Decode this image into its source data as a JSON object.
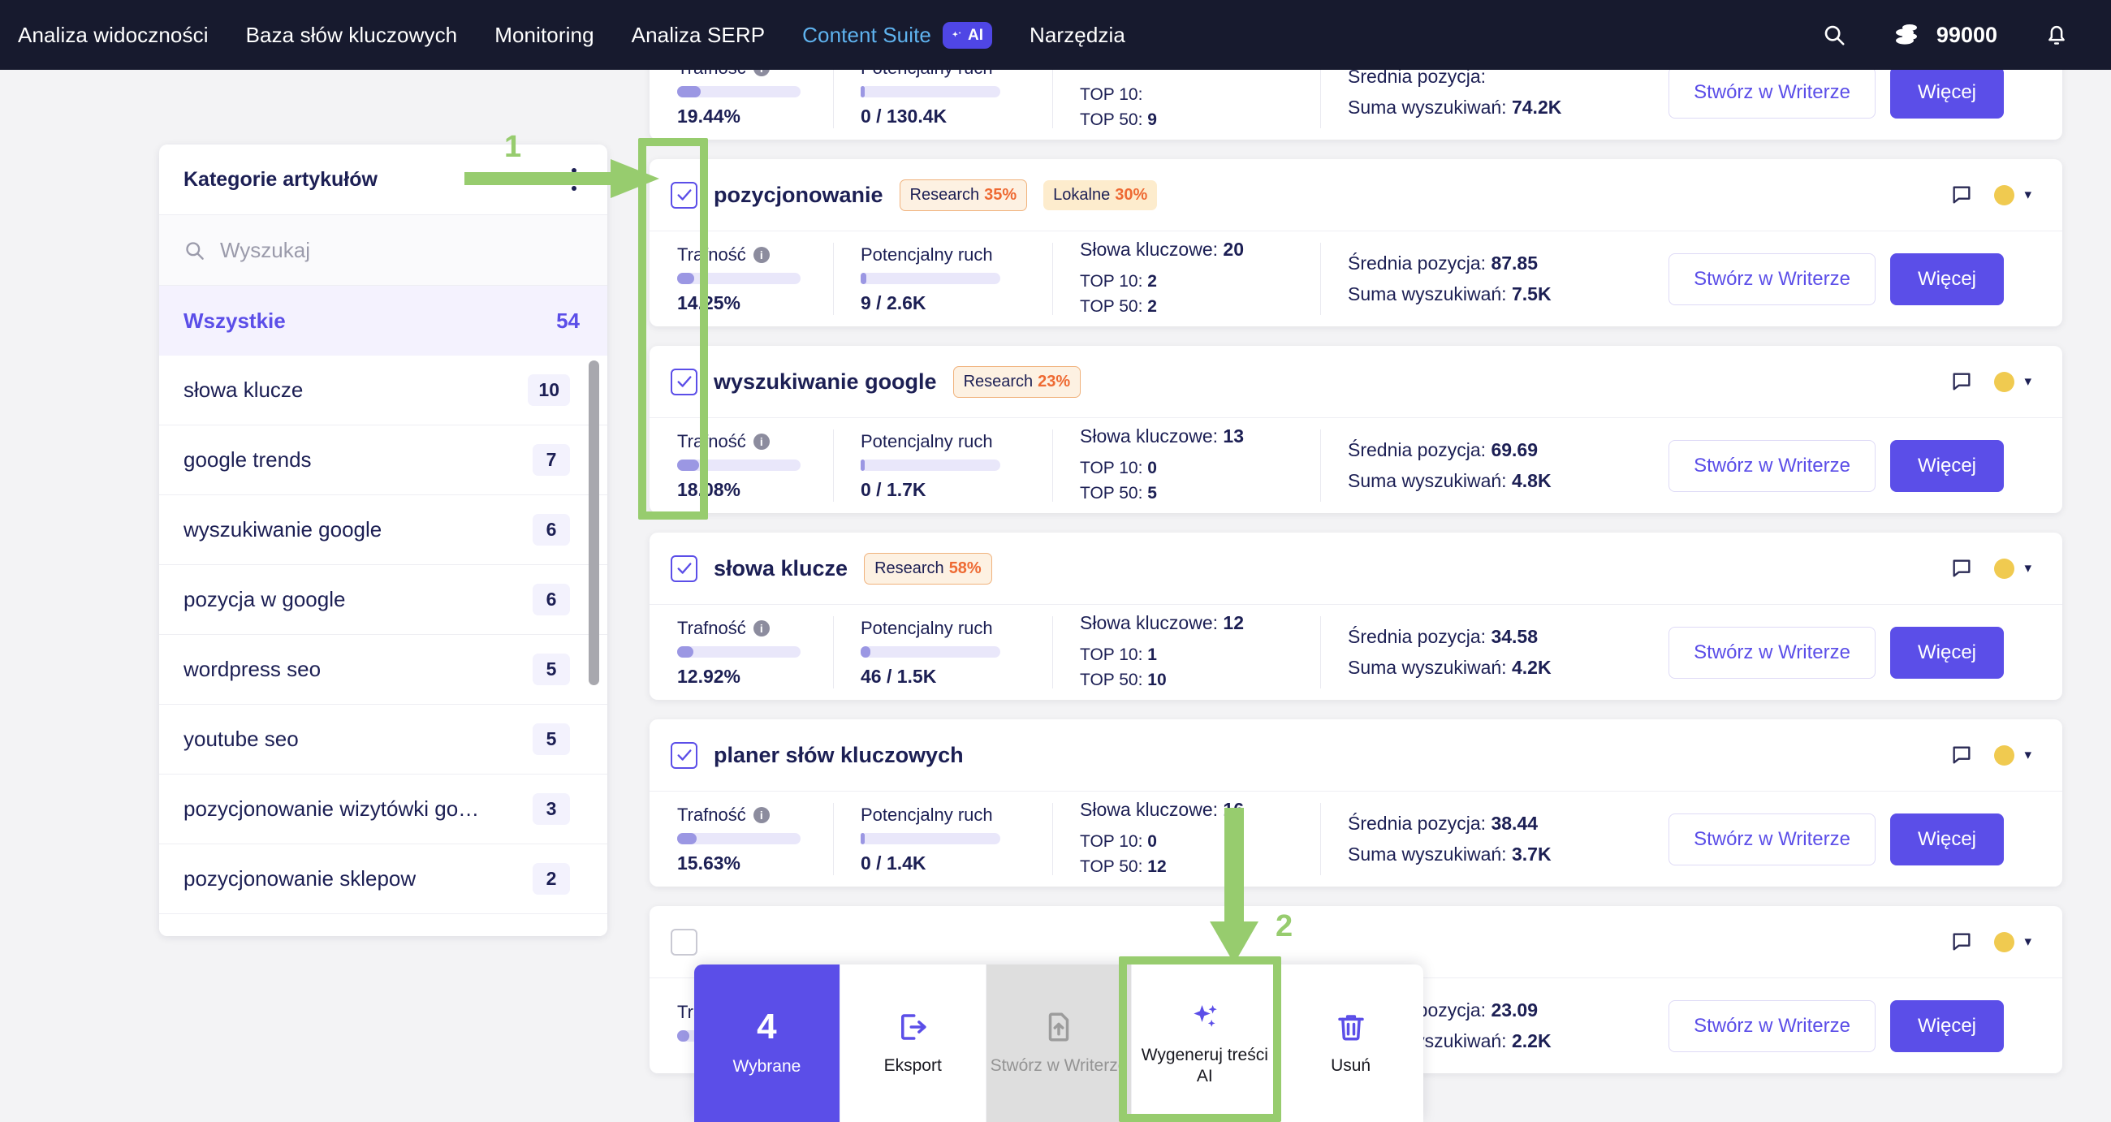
{
  "topnav": {
    "items": [
      {
        "label": "Analiza widoczności",
        "active": false
      },
      {
        "label": "Baza słów kluczowych",
        "active": false
      },
      {
        "label": "Monitoring",
        "active": false
      },
      {
        "label": "Analiza SERP",
        "active": false
      },
      {
        "label": "Content Suite",
        "active": true,
        "badge": "AI"
      },
      {
        "label": "Narzędzia",
        "active": false
      }
    ],
    "ai_badge_label": "AI",
    "credits": "99000",
    "search_icon": "search-icon",
    "coins_icon": "coins-icon",
    "bell_icon": "bell-icon",
    "accent_active": "#5fb3ef",
    "bg": "#171a2e"
  },
  "sidebar": {
    "title": "Kategorie artykułów",
    "menu_icon": "kebab-menu-icon",
    "search": {
      "placeholder": "Wyszukaj",
      "value": "",
      "icon": "search-icon"
    },
    "all": {
      "label": "Wszystkie",
      "count": "54"
    },
    "items": [
      {
        "label": "słowa klucze",
        "count": "10"
      },
      {
        "label": "google trends",
        "count": "7"
      },
      {
        "label": "wyszukiwanie google",
        "count": "6"
      },
      {
        "label": "pozycja w google",
        "count": "6"
      },
      {
        "label": "wordpress seo",
        "count": "5"
      },
      {
        "label": "youtube seo",
        "count": "5"
      },
      {
        "label": "pozycjonowanie wizytówki go…",
        "count": "3"
      },
      {
        "label": "pozycjonowanie sklepow",
        "count": "2"
      },
      {
        "label": "",
        "count": ""
      }
    ]
  },
  "labels": {
    "trafnosc": "Trafność",
    "potencjalny_ruch": "Potencjalny ruch",
    "slowa_kluczowe": "Słowa kluczowe:",
    "top10": "TOP 10:",
    "top50": "TOP 50:",
    "srednia_pozycja": "Średnia pozycja:",
    "suma_wyszukiwan": "Suma wyszukiwań:",
    "btn_writer": "Stwórz w Writerze",
    "btn_more": "Więcej",
    "info_icon": "info-icon",
    "comment_icon": "comment-icon",
    "status_dot": "status-dot-icon",
    "chevron": "chevron-down-icon"
  },
  "cards": [
    {
      "name": "",
      "checked": true,
      "badges": [],
      "trafnosc": "19.44%",
      "trafnosc_pct": 19,
      "ruch": "0 / 130.4K",
      "ruch_pct": 3,
      "keywords": "",
      "top10": "",
      "top50": "9",
      "srednia": "",
      "suma": "74.2K",
      "partial": true
    },
    {
      "name": "pozycjonowanie",
      "checked": true,
      "badges": [
        {
          "key": "Research",
          "value": "35%",
          "style": "outline"
        },
        {
          "key": "Lokalne",
          "value": "30%",
          "style": "solid"
        }
      ],
      "trafnosc": "14.25%",
      "trafnosc_pct": 14,
      "ruch": "9 / 2.6K",
      "ruch_pct": 4,
      "keywords": "20",
      "top10": "2",
      "top50": "2",
      "srednia": "87.85",
      "suma": "7.5K"
    },
    {
      "name": "wyszukiwanie google",
      "checked": true,
      "badges": [
        {
          "key": "Research",
          "value": "23%",
          "style": "outline"
        }
      ],
      "trafnosc": "18.08%",
      "trafnosc_pct": 18,
      "ruch": "0 / 1.7K",
      "ruch_pct": 3,
      "keywords": "13",
      "top10": "0",
      "top50": "5",
      "srednia": "69.69",
      "suma": "4.8K"
    },
    {
      "name": "słowa klucze",
      "checked": true,
      "badges": [
        {
          "key": "Research",
          "value": "58%",
          "style": "outline"
        }
      ],
      "trafnosc": "12.92%",
      "trafnosc_pct": 13,
      "ruch": "46 / 1.5K",
      "ruch_pct": 7,
      "keywords": "12",
      "top10": "1",
      "top50": "10",
      "srednia": "34.58",
      "suma": "4.2K"
    },
    {
      "name": "planer słów kluczowych",
      "checked": true,
      "badges": [],
      "trafnosc": "15.63%",
      "trafnosc_pct": 16,
      "ruch": "0 / 1.4K",
      "ruch_pct": 3,
      "keywords": "16",
      "top10": "0",
      "top50": "12",
      "srednia": "38.44",
      "suma": "3.7K"
    },
    {
      "name": "",
      "checked": false,
      "badges": [],
      "trafnosc": "",
      "trafnosc_pct": 10,
      "ruch": "",
      "ruch_pct": 3,
      "keywords": "",
      "top10": "",
      "top50": "",
      "srednia": "23.09",
      "suma": "2.2K"
    }
  ],
  "toolbar": {
    "selected_count": "4",
    "selected_label": "Wybrane",
    "items": [
      {
        "label": "Eksport",
        "icon": "export-icon",
        "disabled": false
      },
      {
        "label": "Stwórz w Writerze",
        "icon": "file-upload-icon",
        "disabled": true
      },
      {
        "label": "Wygeneruj treści AI",
        "icon": "sparkles-icon",
        "disabled": false
      },
      {
        "label": "Usuń",
        "icon": "trash-icon",
        "disabled": false
      }
    ]
  },
  "annotations": {
    "color": "#97cc6e",
    "marker_1": "1",
    "marker_2": "2"
  }
}
